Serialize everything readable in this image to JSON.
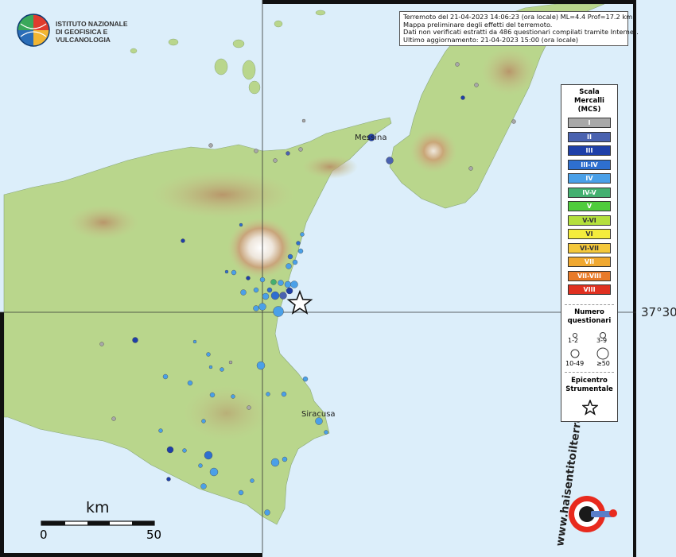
{
  "institute": {
    "line1": "ISTITUTO NAZIONALE",
    "line2": "DI GEOFISICA E VULCANOLOGIA"
  },
  "info": {
    "line1": "Terremoto del 21-04-2023 14:06:23 (ora locale) ML=4.4 Prof=17.2 km",
    "line2": "Mappa preliminare degli effetti del terremoto.",
    "line3": "Dati non verificati estratti da 486 questionari compilati tramite Internet.",
    "line4": "Ultimo aggiornamento: 21-04-2023 15:00 (ora locale)"
  },
  "places": {
    "messina": "Messina",
    "siracusa": "Siracusa"
  },
  "coordinate_label": "37°30'",
  "scale_bar": {
    "unit": "km",
    "start": "0",
    "end": "50"
  },
  "legend": {
    "scale_title_1": "Scala",
    "scale_title_2": "Mercalli",
    "scale_title_3": "(MCS)",
    "classes": [
      {
        "label": "I",
        "color": "#a8a8a8"
      },
      {
        "label": "II",
        "color": "#4a62b0"
      },
      {
        "label": "III",
        "color": "#1e3fa8"
      },
      {
        "label": "III-IV",
        "color": "#2e6fd0"
      },
      {
        "label": "IV",
        "color": "#4aa0e8"
      },
      {
        "label": "IV-V",
        "color": "#44b070"
      },
      {
        "label": "V",
        "color": "#4fcc3c"
      },
      {
        "label": "V-VI",
        "color": "#b4e03c"
      },
      {
        "label": "VI",
        "color": "#f4ec3c"
      },
      {
        "label": "VI-VII",
        "color": "#f4c83c"
      },
      {
        "label": "VII",
        "color": "#f0a830"
      },
      {
        "label": "VII-VIII",
        "color": "#e87a28"
      },
      {
        "label": "VIII",
        "color": "#e03020"
      }
    ],
    "count_title_1": "Numero",
    "count_title_2": "questionari",
    "count_classes": [
      "1-2",
      "3-9",
      "10-49",
      "≥50"
    ],
    "epicenter_title_1": "Epicentro",
    "epicenter_title_2": "Strumentale"
  },
  "watermark": "www.haisentitoilterremoto.it",
  "colors": {
    "sea": "#dceefa",
    "land_low": "#b9d78e",
    "land_mid": "#d6cd93",
    "land_high": "#bfa477",
    "etna_summit": "#f5f0ec"
  }
}
